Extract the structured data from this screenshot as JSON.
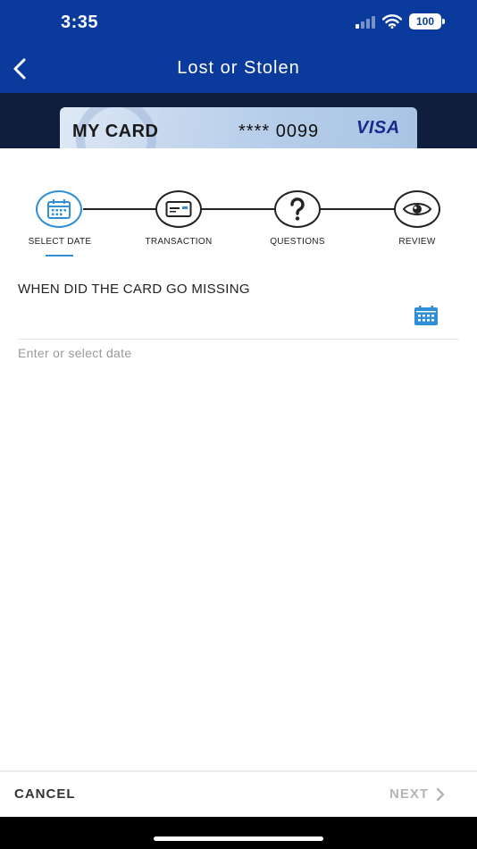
{
  "status_bar": {
    "time": "3:35",
    "battery": "100"
  },
  "header": {
    "title": "Lost or Stolen"
  },
  "card": {
    "name": "MY CARD",
    "number": "**** 0099",
    "brand": "VISA"
  },
  "steps": [
    {
      "label": "SELECT DATE",
      "icon": "calendar-icon",
      "active": true
    },
    {
      "label": "TRANSACTION",
      "icon": "card-icon",
      "active": false
    },
    {
      "label": "QUESTIONS",
      "icon": "question-mark-icon",
      "active": false
    },
    {
      "label": "REVIEW",
      "icon": "eye-icon",
      "active": false
    }
  ],
  "form": {
    "question": "WHEN DID THE CARD GO MISSING",
    "date_value": "",
    "date_placeholder": "Enter or select date"
  },
  "footer": {
    "cancel_label": "CANCEL",
    "next_label": "NEXT"
  },
  "colors": {
    "header_bg": "#0a3a9c",
    "accent": "#2f8fd6",
    "disabled": "#b5b5b5"
  }
}
